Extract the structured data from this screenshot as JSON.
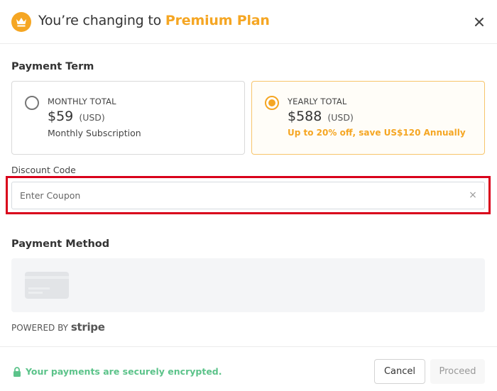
{
  "header": {
    "title_prefix": "You’re changing to ",
    "plan_name": "Premium Plan",
    "icon": "crown-icon",
    "close_icon": "close-icon"
  },
  "payment_term": {
    "label": "Payment Term",
    "options": [
      {
        "id": "monthly",
        "kicker": "MONTHLY TOTAL",
        "price": "$59",
        "currency": "(USD)",
        "subtitle": "Monthly Subscription",
        "selected": false
      },
      {
        "id": "yearly",
        "kicker": "YEARLY TOTAL",
        "price": "$588",
        "currency": "(USD)",
        "subtitle": "Up to 20% off, save US$120 Annually",
        "selected": true
      }
    ]
  },
  "discount": {
    "label": "Discount Code",
    "value": "",
    "placeholder": "Enter Coupon",
    "clear_icon": "×"
  },
  "payment_method": {
    "label": "Payment Method",
    "powered_by": "POWERED BY",
    "provider": "stripe"
  },
  "footer": {
    "secure_text": "Your payments are securely encrypted.",
    "cancel_label": "Cancel",
    "proceed_label": "Proceed"
  },
  "colors": {
    "accent": "#f5a623",
    "highlight_border": "#d9001b",
    "secure_green": "#5cc38a"
  }
}
